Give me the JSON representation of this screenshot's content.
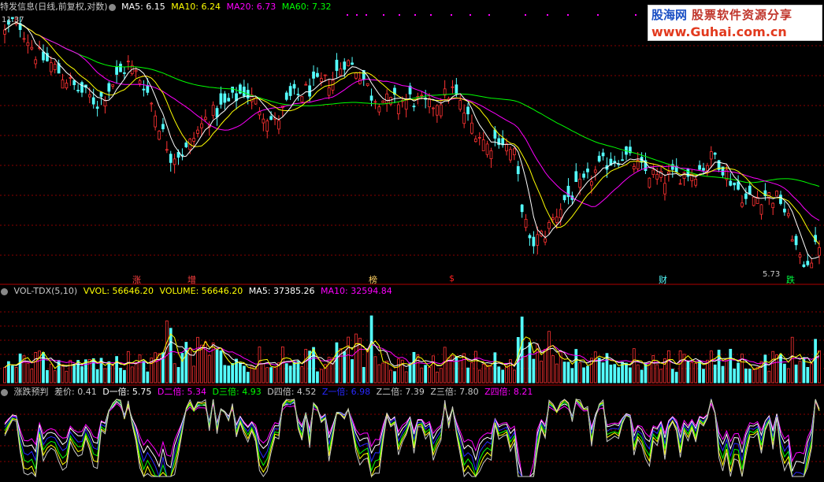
{
  "price_header": {
    "title": "特发信息(日线,前复权,对数)",
    "ma5": "MA5: 6.15",
    "ma10": "MA10: 6.24",
    "ma20": "MA20: 6.73",
    "ma60": "MA60: 7.32",
    "high_label": "11.37",
    "low_label": "5.73"
  },
  "volume_header": {
    "title": "VOL-TDX(5,10)",
    "vvol": "VVOL: 56646.20",
    "volume": "VOLUME: 56646.20",
    "ma5": "MA5: 37385.26",
    "ma10": "MA10: 32594.84"
  },
  "indicator_header": {
    "title": "涨跌预判",
    "diff": "差价: 0.41",
    "d1": "D一倍: 5.75",
    "d2": "D二倍: 5.34",
    "d3": "D三倍: 4.93",
    "d4": "D四倍: 4.52",
    "z1": "Z一倍: 6.98",
    "z2": "Z二倍: 7.39",
    "z3": "Z三倍: 7.80",
    "z4": "Z四倍: 8.21"
  },
  "event_markers": [
    "涨",
    "增",
    "榜",
    "$",
    "财",
    "跌"
  ],
  "watermark": {
    "brand": "股海网",
    "slogan": "股票软件资源分享",
    "url": "www.Guhai.com.cn"
  },
  "colors": {
    "up": "#ff3232",
    "down": "#54ffff",
    "ma5": "#ffffff",
    "ma10": "#ffff00",
    "ma20": "#ff00ff",
    "ma60": "#00ff00",
    "vvol": "#ffff00",
    "grid": "#8a0000",
    "divider": "#b00000",
    "z1": "#2828ff"
  },
  "chart_data": [
    {
      "type": "candlestick",
      "title": "特发信息(日线,前复权,对数)",
      "y_scale": "log",
      "y_range": [
        5.73,
        11.37
      ],
      "max_price": 11.37,
      "min_price": 5.73,
      "last_moving_averages": {
        "MA5": 6.15,
        "MA10": 6.24,
        "MA20": 6.73,
        "MA60": 7.32
      },
      "anchors": [
        [
          0,
          10.9
        ],
        [
          3,
          11.37
        ],
        [
          8,
          10.3
        ],
        [
          12,
          10.0
        ],
        [
          18,
          9.4
        ],
        [
          24,
          9.0
        ],
        [
          28,
          9.5
        ],
        [
          32,
          10.0
        ],
        [
          36,
          9.5
        ],
        [
          40,
          8.5
        ],
        [
          43,
          7.8
        ],
        [
          47,
          7.9
        ],
        [
          52,
          8.6
        ],
        [
          58,
          9.0
        ],
        [
          62,
          9.3
        ],
        [
          66,
          8.9
        ],
        [
          70,
          8.5
        ],
        [
          74,
          9.1
        ],
        [
          80,
          9.4
        ],
        [
          85,
          9.6
        ],
        [
          88,
          10.1
        ],
        [
          92,
          9.8
        ],
        [
          95,
          9.2
        ],
        [
          100,
          9.0
        ],
        [
          105,
          9.1
        ],
        [
          110,
          8.9
        ],
        [
          116,
          9.3
        ],
        [
          120,
          8.6
        ],
        [
          125,
          8.0
        ],
        [
          128,
          8.2
        ],
        [
          132,
          7.8
        ],
        [
          134,
          6.8
        ],
        [
          136,
          6.1
        ],
        [
          140,
          6.3
        ],
        [
          145,
          6.9
        ],
        [
          150,
          7.2
        ],
        [
          155,
          7.6
        ],
        [
          160,
          7.8
        ],
        [
          165,
          7.5
        ],
        [
          170,
          7.3
        ],
        [
          175,
          7.4
        ],
        [
          180,
          7.5
        ],
        [
          184,
          7.8
        ],
        [
          188,
          7.3
        ],
        [
          192,
          6.9
        ],
        [
          197,
          7.0
        ],
        [
          201,
          6.9
        ],
        [
          204,
          6.3
        ],
        [
          206,
          5.8
        ],
        [
          209,
          5.9
        ],
        [
          211,
          6.15
        ]
      ],
      "n_bars": 212
    },
    {
      "type": "bar",
      "title": "VOL-TDX(5,10)",
      "last_value": 56646.2,
      "series": [
        {
          "name": "MA5",
          "last_value": 37385.26
        },
        {
          "name": "MA10",
          "last_value": 32594.84
        }
      ]
    },
    {
      "type": "line",
      "title": "涨跌预判",
      "series": [
        {
          "name": "D一倍",
          "last_value": 5.75
        },
        {
          "name": "D二倍",
          "last_value": 5.34
        },
        {
          "name": "D三倍",
          "last_value": 4.93
        },
        {
          "name": "D四倍",
          "last_value": 4.52
        },
        {
          "name": "Z一倍",
          "last_value": 6.98
        },
        {
          "name": "Z二倍",
          "last_value": 7.39
        },
        {
          "name": "Z三倍",
          "last_value": 7.8
        },
        {
          "name": "Z四倍",
          "last_value": 8.21
        }
      ]
    }
  ]
}
